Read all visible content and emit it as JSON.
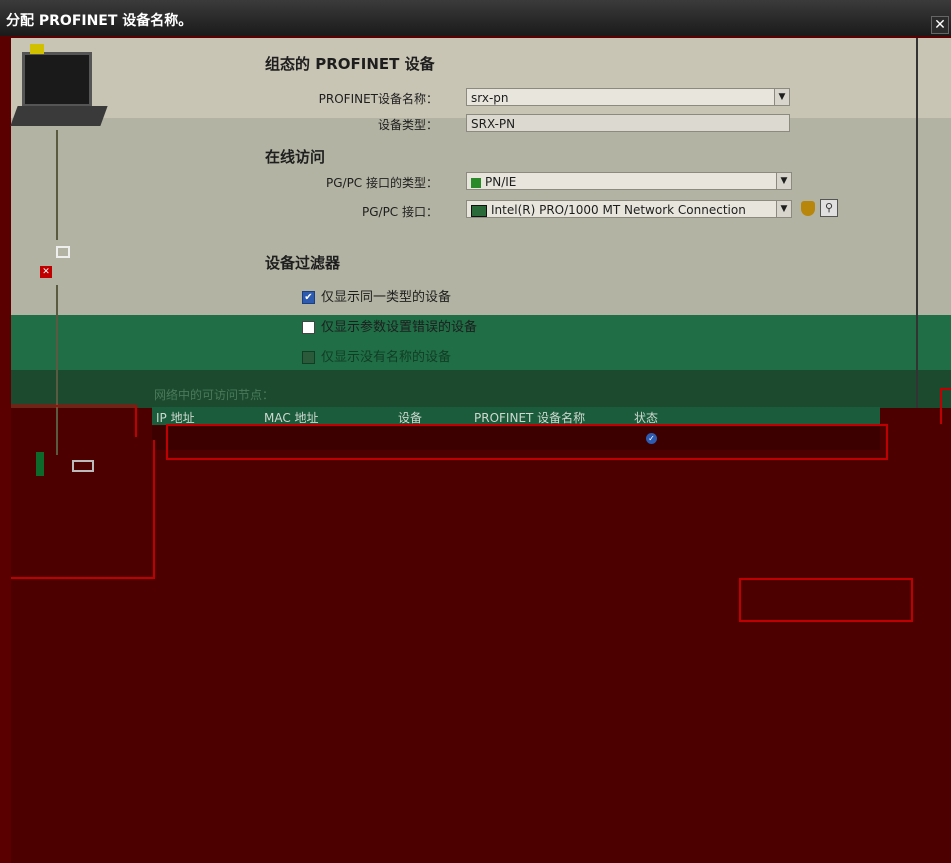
{
  "dialog": {
    "title": "分配 PROFINET 设备名称。"
  },
  "configured": {
    "heading": "组态的 PROFINET 设备",
    "device_name_label": "PROFINET设备名称：",
    "device_name_value": "srx-pn",
    "device_type_label": "设备类型：",
    "device_type_value": "SRX-PN"
  },
  "online": {
    "heading": "在线访问",
    "pgpc_type_label": "PG/PC 接口的类型：",
    "pgpc_type_value": "PN/IE",
    "pgpc_if_label": "PG/PC 接口：",
    "pgpc_if_value": "Intel(R) PRO/1000 MT Network Connection"
  },
  "filter": {
    "heading": "设备过滤器",
    "options": [
      {
        "label": "仅显示同一类型的设备",
        "checked": true
      },
      {
        "label": "仅显示参数设置错误的设备",
        "checked": false
      },
      {
        "label": "仅显示没有名称的设备",
        "checked": false
      }
    ]
  },
  "nodes": {
    "heading": "网络中的可访问节点：",
    "columns": [
      "IP 地址",
      "MAC 地址",
      "设备",
      "PROFINET 设备名称",
      "状态"
    ]
  },
  "colors": {
    "accent_green": "#1f6e46",
    "marker_red": "#c00000"
  }
}
